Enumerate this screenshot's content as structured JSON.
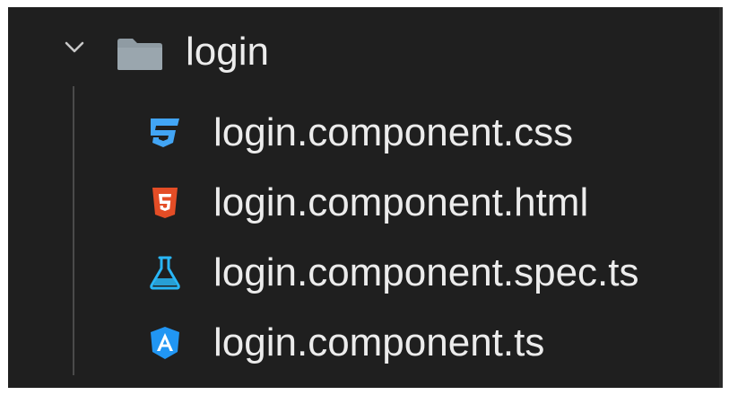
{
  "explorer": {
    "folder": {
      "label": "login",
      "expanded": true,
      "icon": "folder-icon"
    },
    "files": [
      {
        "label": "login.component.css",
        "icon": "css-icon",
        "color": "#42a5f5"
      },
      {
        "label": "login.component.html",
        "icon": "html5-icon",
        "color": "#e44d26"
      },
      {
        "label": "login.component.spec.ts",
        "icon": "test-flask-icon",
        "color": "#29b6f6"
      },
      {
        "label": "login.component.ts",
        "icon": "angular-icon",
        "color": "#2196f3"
      }
    ]
  },
  "colors": {
    "background": "#1f1f1f",
    "text": "#ececec",
    "folder": "#8f9ba3"
  }
}
